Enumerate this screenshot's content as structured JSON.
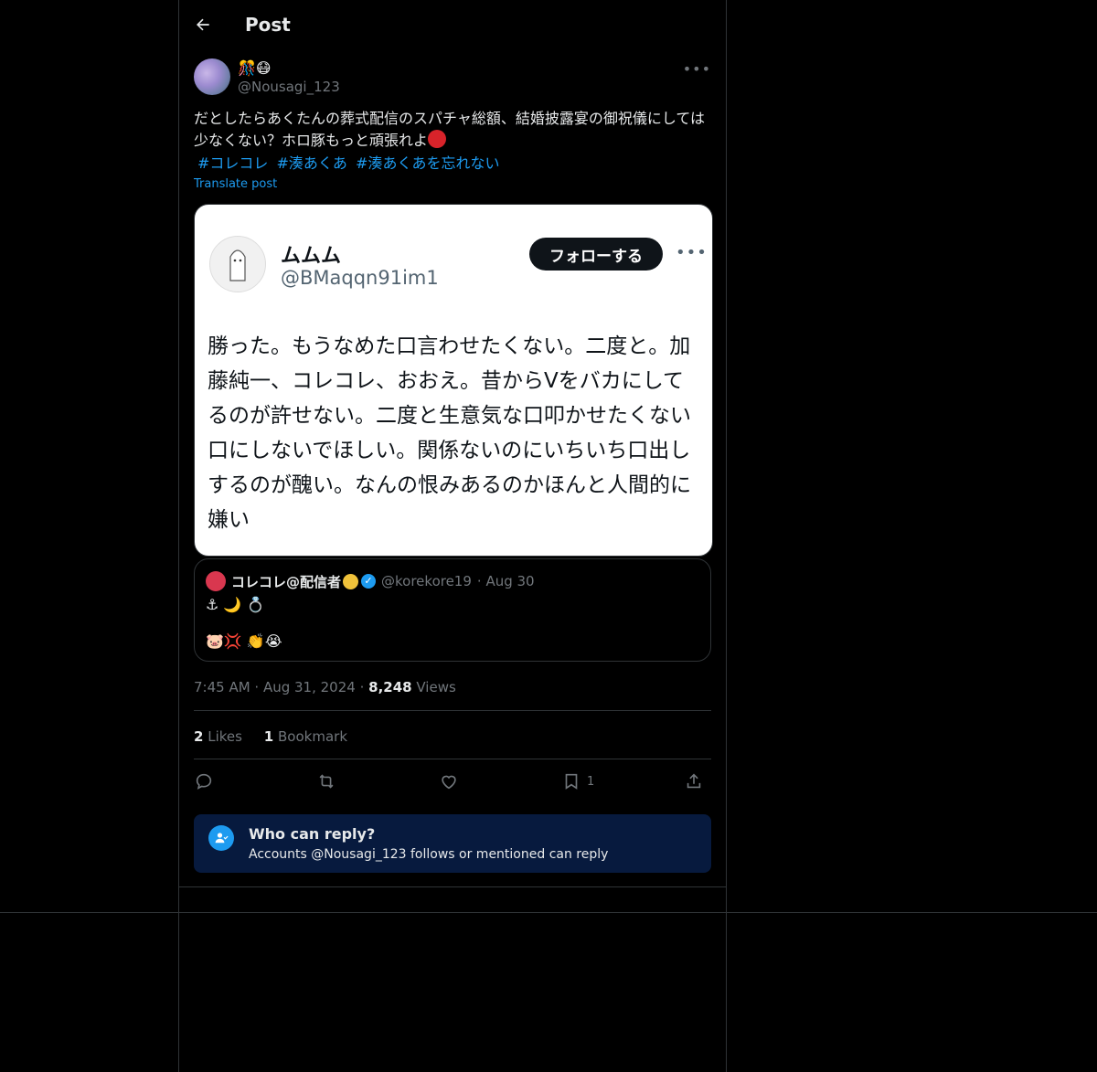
{
  "header": {
    "title": "Post"
  },
  "post": {
    "author_display_name": "🎊😷",
    "author_handle": "@Nousagi_123",
    "more_icon": "ellipsis-icon",
    "text": "だとしたらあくたんの葬式配信のスパチャ総額、結婚披露宴の御祝儀にしては少なくない？ホロ豚もっと頑張れよ",
    "hashtags": [
      "#コレコレ",
      "#湊あくあ",
      "#湊あくあを忘れない"
    ],
    "translate_label": "Translate post",
    "timestamp": "7:45 AM · Aug 31, 2024 ·",
    "views_count": "8,248",
    "views_label": "Views",
    "likes_count": "2",
    "likes_label": "Likes",
    "bookmarks_count": "1",
    "bookmarks_label": "Bookmark",
    "bookmark_action_count": "1"
  },
  "embedded_image": {
    "name": "ムムム",
    "handle": "@BMaqqn91im1",
    "follow_label": "フォローする",
    "text": "勝った。もうなめた口言わせたくない。二度と。加藤純一、コレコレ、おおえ。昔からVをバカにしてるのが許せない。二度と生意気な口叩かせたくない口にしないでほしい。関係ないのにいちいち口出しするのが醜い。なんの恨みあるのかほんと人間的に嫌い"
  },
  "quoted_post": {
    "name": "コレコレ@配信者",
    "handle": "@korekore19",
    "date": "· Aug 30",
    "line1": "⚓ 🌙 💍",
    "line2": "🐷💢 👏😭"
  },
  "reply_restriction": {
    "title": "Who can reply?",
    "subtitle": "Accounts @Nousagi_123 follows or mentioned can reply"
  },
  "colors": {
    "accent": "#1d9bf0",
    "background": "#000000",
    "reply_box": "#071a3e"
  }
}
